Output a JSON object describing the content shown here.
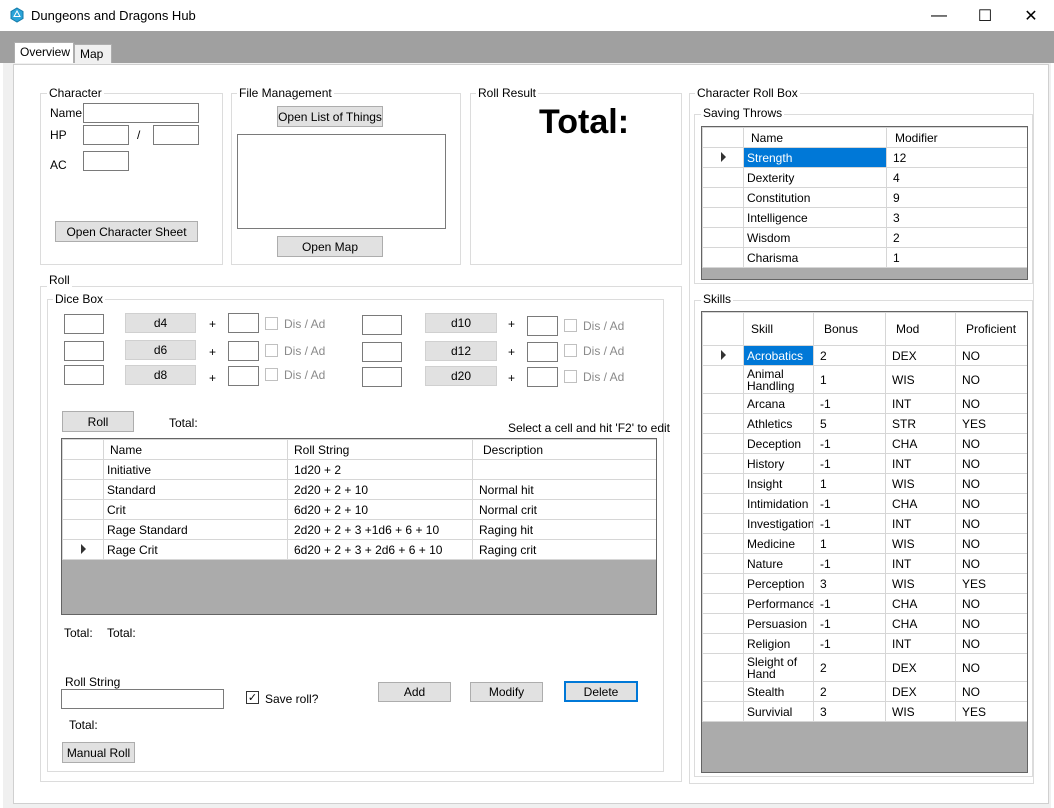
{
  "window": {
    "title": "Dungeons and Dragons Hub",
    "minimize_glyph": "—",
    "maximize_glyph": "☐",
    "close_glyph": "✕"
  },
  "tabs": [
    "Overview",
    "Map"
  ],
  "character": {
    "group_label": "Character",
    "name_label": "Name",
    "hp_label": "HP",
    "hp_sep": "/",
    "ac_label": "AC",
    "open_sheet_button": "Open Character Sheet"
  },
  "file_management": {
    "group_label": "File Management",
    "open_list_button": "Open List of Things",
    "open_map_button": "Open Map"
  },
  "roll_result": {
    "group_label": "Roll Result",
    "total_label": "Total:"
  },
  "roll": {
    "group_label": "Roll",
    "dice_box_label": "Dice Box",
    "plus": "+",
    "dis_ad": "Dis / Ad",
    "dice_left": [
      "d4",
      "d6",
      "d8"
    ],
    "dice_right": [
      "d10",
      "d12",
      "d20"
    ],
    "roll_button": "Roll",
    "total_label": "Total:",
    "hint": "Select a cell and hit 'F2' to edit",
    "grid_headers": [
      "Name",
      "Roll String",
      "Description"
    ],
    "grid_rows": [
      {
        "name": "Initiative",
        "roll": "1d20 + 2",
        "desc": ""
      },
      {
        "name": "Standard",
        "roll": "2d20 + 2 + 10",
        "desc": "Normal hit"
      },
      {
        "name": "Crit",
        "roll": "6d20 + 2 + 10",
        "desc": "Normal crit"
      },
      {
        "name": "Rage Standard",
        "roll": "2d20 + 2 + 3 +1d6 + 6 + 10",
        "desc": "Raging hit"
      },
      {
        "name": "Rage Crit",
        "roll": "6d20 + 2 + 3 + 2d6 + 6 + 10",
        "desc": "Raging crit"
      }
    ],
    "total_a": "Total:",
    "total_b": "Total:",
    "roll_string_label": "Roll String",
    "save_roll_label": "Save roll?",
    "total_c": "Total:",
    "add_button": "Add",
    "modify_button": "Modify",
    "delete_button": "Delete",
    "manual_roll_button": "Manual Roll"
  },
  "character_roll_box": {
    "group_label": "Character Roll Box",
    "saving_throws_label": "Saving Throws",
    "saving_headers": [
      "Name",
      "Modifier"
    ],
    "saving_rows": [
      {
        "name": "Strength",
        "mod": "12"
      },
      {
        "name": "Dexterity",
        "mod": "4"
      },
      {
        "name": "Constitution",
        "mod": "9"
      },
      {
        "name": "Intelligence",
        "mod": "3"
      },
      {
        "name": "Wisdom",
        "mod": "2"
      },
      {
        "name": "Charisma",
        "mod": "1"
      }
    ],
    "skills_label": "Skills",
    "skill_headers": [
      "Skill",
      "Bonus",
      "Mod",
      "Proficient"
    ],
    "skill_rows": [
      {
        "skill": "Acrobatics",
        "bonus": "2",
        "mod": "DEX",
        "prof": "NO"
      },
      {
        "skill": "Animal Handling",
        "bonus": "1",
        "mod": "WIS",
        "prof": "NO"
      },
      {
        "skill": "Arcana",
        "bonus": "-1",
        "mod": "INT",
        "prof": "NO"
      },
      {
        "skill": "Athletics",
        "bonus": "5",
        "mod": "STR",
        "prof": "YES"
      },
      {
        "skill": "Deception",
        "bonus": "-1",
        "mod": "CHA",
        "prof": "NO"
      },
      {
        "skill": "History",
        "bonus": "-1",
        "mod": "INT",
        "prof": "NO"
      },
      {
        "skill": "Insight",
        "bonus": "1",
        "mod": "WIS",
        "prof": "NO"
      },
      {
        "skill": "Intimidation",
        "bonus": "-1",
        "mod": "CHA",
        "prof": "NO"
      },
      {
        "skill": "Investigation",
        "bonus": "-1",
        "mod": "INT",
        "prof": "NO"
      },
      {
        "skill": "Medicine",
        "bonus": "1",
        "mod": "WIS",
        "prof": "NO"
      },
      {
        "skill": "Nature",
        "bonus": "-1",
        "mod": "INT",
        "prof": "NO"
      },
      {
        "skill": "Perception",
        "bonus": "3",
        "mod": "WIS",
        "prof": "YES"
      },
      {
        "skill": "Performance",
        "bonus": "-1",
        "mod": "CHA",
        "prof": "NO"
      },
      {
        "skill": "Persuasion",
        "bonus": "-1",
        "mod": "CHA",
        "prof": "NO"
      },
      {
        "skill": "Religion",
        "bonus": "-1",
        "mod": "INT",
        "prof": "NO"
      },
      {
        "skill": "Sleight of Hand",
        "bonus": "2",
        "mod": "DEX",
        "prof": "NO"
      },
      {
        "skill": "Stealth",
        "bonus": "2",
        "mod": "DEX",
        "prof": "NO"
      },
      {
        "skill": "Survivial",
        "bonus": "3",
        "mod": "WIS",
        "prof": "YES"
      }
    ]
  },
  "colors": {
    "selection": "#0078d7",
    "grid_empty": "#ababab",
    "tab_strip": "#a0a0a0"
  }
}
